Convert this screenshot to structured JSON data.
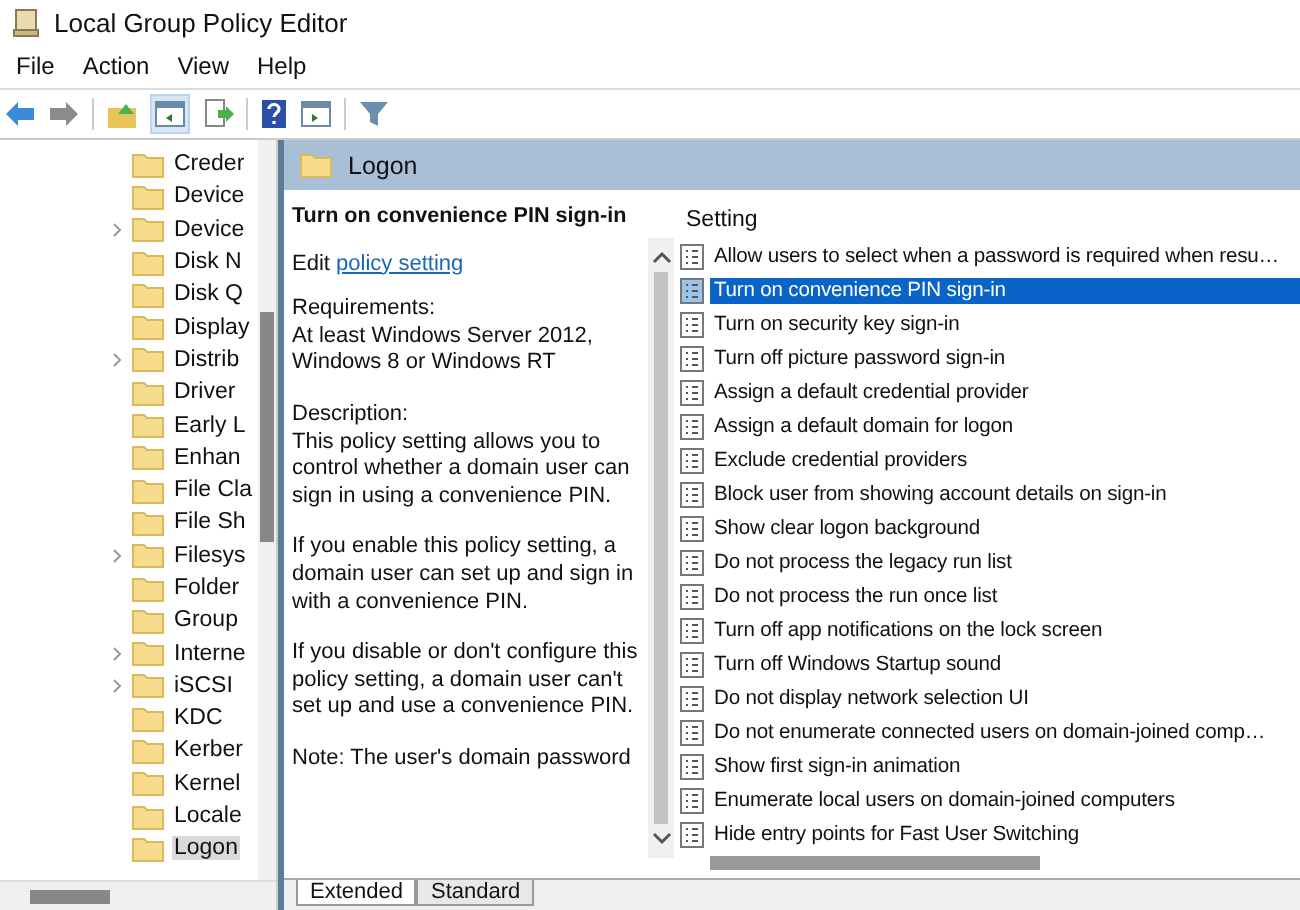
{
  "window": {
    "title": "Local Group Policy Editor"
  },
  "menu": [
    "File",
    "Action",
    "View",
    "Help"
  ],
  "tree": {
    "items": [
      {
        "label": "Creder",
        "expandable": false,
        "selected": false
      },
      {
        "label": "Device",
        "expandable": false,
        "selected": false
      },
      {
        "label": "Device",
        "expandable": true,
        "selected": false
      },
      {
        "label": "Disk N",
        "expandable": false,
        "selected": false
      },
      {
        "label": "Disk Q",
        "expandable": false,
        "selected": false
      },
      {
        "label": "Display",
        "expandable": false,
        "selected": false
      },
      {
        "label": "Distrib",
        "expandable": true,
        "selected": false
      },
      {
        "label": "Driver",
        "expandable": false,
        "selected": false
      },
      {
        "label": "Early L",
        "expandable": false,
        "selected": false
      },
      {
        "label": "Enhan",
        "expandable": false,
        "selected": false
      },
      {
        "label": "File Cla",
        "expandable": false,
        "selected": false
      },
      {
        "label": "File Sh",
        "expandable": false,
        "selected": false
      },
      {
        "label": "Filesys",
        "expandable": true,
        "selected": false
      },
      {
        "label": "Folder",
        "expandable": false,
        "selected": false
      },
      {
        "label": "Group",
        "expandable": false,
        "selected": false
      },
      {
        "label": "Interne",
        "expandable": true,
        "selected": false
      },
      {
        "label": "iSCSI",
        "expandable": true,
        "selected": false
      },
      {
        "label": "KDC",
        "expandable": false,
        "selected": false
      },
      {
        "label": "Kerber",
        "expandable": false,
        "selected": false
      },
      {
        "label": "Kernel",
        "expandable": false,
        "selected": false
      },
      {
        "label": "Locale",
        "expandable": false,
        "selected": false
      },
      {
        "label": "Logon",
        "expandable": false,
        "selected": true
      }
    ]
  },
  "header": {
    "title": "Logon"
  },
  "description": {
    "title": "Turn on convenience PIN sign-in",
    "edit_prefix": "Edit",
    "edit_link": "policy setting",
    "paragraphs": [
      "Requirements:\nAt least Windows Server 2012, Windows 8 or Windows RT",
      "Description:\nThis policy setting allows you to control whether a domain user can sign in using a convenience PIN.",
      "If you enable this policy setting, a domain user can set up and sign in with a convenience PIN.",
      "If you disable or don't configure this policy setting, a domain user can't set up and use a convenience PIN.",
      "Note: The user's domain password"
    ]
  },
  "list": {
    "column": "Setting",
    "rows": [
      {
        "label": "Allow users to select when a password is required when resu…",
        "selected": false
      },
      {
        "label": "Turn on convenience PIN sign-in",
        "selected": true
      },
      {
        "label": "Turn on security key sign-in",
        "selected": false
      },
      {
        "label": "Turn off picture password sign-in",
        "selected": false
      },
      {
        "label": "Assign a default credential provider",
        "selected": false
      },
      {
        "label": "Assign a default domain for logon",
        "selected": false
      },
      {
        "label": "Exclude credential providers",
        "selected": false
      },
      {
        "label": "Block user from showing account details on sign-in",
        "selected": false
      },
      {
        "label": "Show clear logon background",
        "selected": false
      },
      {
        "label": "Do not process the legacy run list",
        "selected": false
      },
      {
        "label": "Do not process the run once list",
        "selected": false
      },
      {
        "label": "Turn off app notifications on the lock screen",
        "selected": false
      },
      {
        "label": "Turn off Windows Startup sound",
        "selected": false
      },
      {
        "label": "Do not display network selection UI",
        "selected": false
      },
      {
        "label": "Do not enumerate connected users on domain-joined comp…",
        "selected": false
      },
      {
        "label": "Show first sign-in animation",
        "selected": false
      },
      {
        "label": "Enumerate local users on domain-joined computers",
        "selected": false
      },
      {
        "label": "Hide entry points for Fast User Switching",
        "selected": false
      }
    ]
  },
  "tabs": [
    {
      "label": "Extended",
      "selected": true
    },
    {
      "label": "Standard",
      "selected": false
    }
  ]
}
